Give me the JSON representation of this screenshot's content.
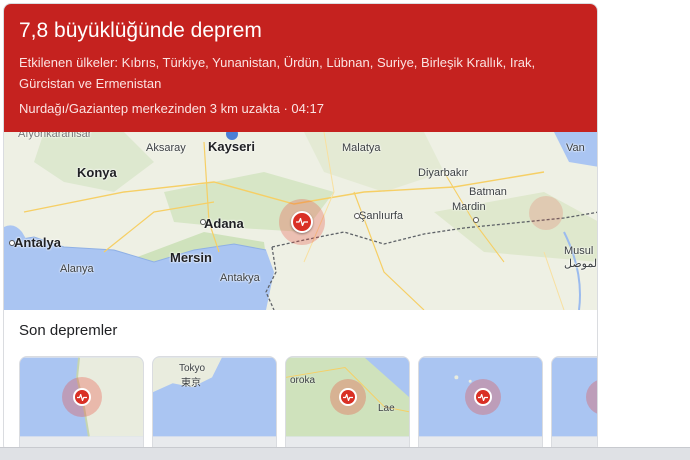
{
  "header": {
    "title": "7,8 büyüklüğünde deprem",
    "affected": "Etkilenen ülkeler: Kıbrıs, Türkiye, Yunanistan, Ürdün, Lübnan, Suriye, Birleşik Krallık, Irak, Gürcistan ve Ermenistan",
    "location": "Nurdağı/Gaziantep merkezinden 3 km uzakta · 04:17",
    "accent_color": "#c5221f"
  },
  "map": {
    "cities": {
      "kayseri": "Kayseri",
      "aksaray": "Aksaray",
      "malatya": "Malatya",
      "van": "Van",
      "konya": "Konya",
      "diyarbakir": "Diyarbakır",
      "batman": "Batman",
      "mardin": "Mardin",
      "adana": "Adana",
      "sanliurfa": "Şanlıurfa",
      "antalya": "Antalya",
      "mersin": "Mersin",
      "alanya": "Alanya",
      "antakya": "Antakya",
      "musul": "Musul",
      "musul_ar": "الموصل",
      "afyon_partial": "Afyonkarahisar"
    },
    "epicenter_icon": "earthquake-wave-icon"
  },
  "recent": {
    "title": "Son depremler",
    "thumbs": [
      {
        "label": "",
        "icon": "earthquake-wave-icon"
      },
      {
        "label": "Tokyo",
        "label2": "東京",
        "icon": ""
      },
      {
        "label": "oroka",
        "label2": "Lae",
        "icon": "earthquake-wave-icon"
      },
      {
        "label": "",
        "icon": "earthquake-wave-icon"
      },
      {
        "label": "",
        "icon": "earthquake-wave-icon"
      }
    ]
  }
}
